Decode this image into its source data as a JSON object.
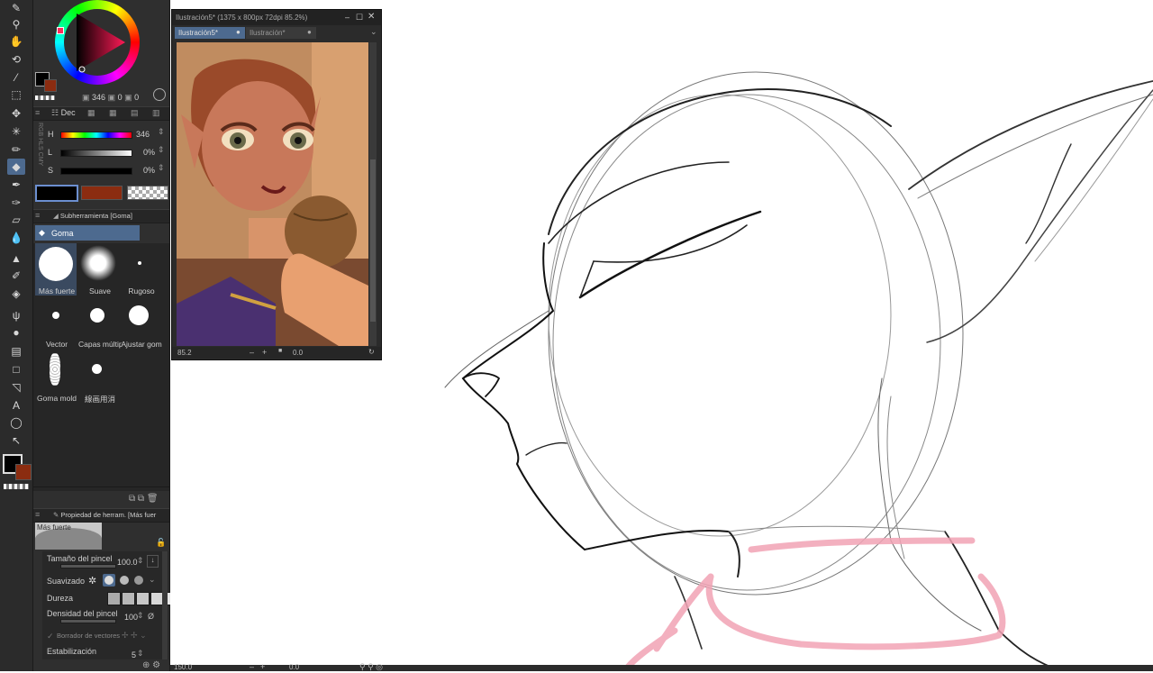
{
  "color": {
    "main": "#000000",
    "sub": "#8b2c10",
    "hue_readout": "346",
    "sat_readout": "0",
    "val_readout": "0",
    "hls": {
      "h_label": "H",
      "h_value": "346",
      "l_label": "L",
      "l_value": "0%",
      "s_label": "S",
      "s_value": "0%"
    },
    "tabs": [
      "Dec",
      "",
      "",
      "",
      ""
    ]
  },
  "subtool": {
    "panel_title": "Subherramienta [Goma]",
    "group": "Goma",
    "brushes": [
      {
        "name": "Más fuerte",
        "selected": true
      },
      {
        "name": "Suave"
      },
      {
        "name": "Rugoso"
      },
      {
        "name": "Vector"
      },
      {
        "name": "Capas múltip"
      },
      {
        "name": "Ajustar gom"
      },
      {
        "name": "Goma mold"
      },
      {
        "name": "線画用消"
      }
    ]
  },
  "tool_property": {
    "panel_title": "Propiedad de herram. [Más fuer",
    "preview_label": "Más fuerte",
    "brush_size_label": "Tamaño del pincel",
    "brush_size_value": "100.0",
    "smoothing_label": "Suavizado",
    "hardness_label": "Dureza",
    "density_label": "Densidad del pincel",
    "density_value": "100",
    "vector_eraser_label": "Borrador de vectores",
    "stabilization_label": "Estabilización",
    "stabilization_value": "5"
  },
  "navigator": {
    "window_title": "Ilustración5* (1375 x 800px 72dpi 85.2%)",
    "tabs": [
      "Ilustración5*",
      "Ilustración*"
    ],
    "zoom": "85.2",
    "rotation": "0.0"
  },
  "canvas_status": {
    "zoom": "150.0",
    "rotation": "0.0"
  }
}
